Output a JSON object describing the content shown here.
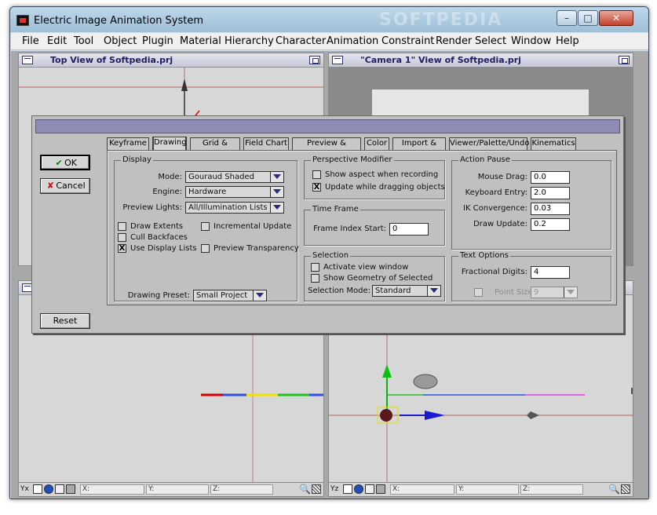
{
  "window": {
    "title": "Electric Image Animation System",
    "watermark": "SOFTPEDIA",
    "minimize": "–",
    "maximize": "□",
    "close": "✕"
  },
  "menu": [
    "File",
    "Edit",
    "Tool",
    "Object",
    "Plugin",
    "Material",
    "Hierarchy",
    "Character",
    "Animation",
    "Constraint",
    "Render",
    "Select",
    "Window",
    "Help"
  ],
  "viewports": {
    "top_left_title": "Top View of Softpedia.prj",
    "top_right_title": "\"Camera 1\" View of Softpedia.prj"
  },
  "status": {
    "axis_left": "Yx",
    "axis_right": "Yz",
    "x_label": "X:",
    "y_label": "Y:",
    "z_label": "Z:"
  },
  "dialog": {
    "ok": "OK",
    "cancel": "Cancel",
    "reset": "Reset",
    "tabs": [
      "Keyframe",
      "Drawing",
      "Grid & Scale",
      "Field Chart",
      "Preview & Render",
      "Color",
      "Import & Data",
      "Viewer/Palette/Undo",
      "Kinematics"
    ],
    "active_tab": "Drawing",
    "display": {
      "title": "Display",
      "mode_label": "Mode:",
      "mode_value": "Gouraud Shaded",
      "engine_label": "Engine:",
      "engine_value": "Hardware",
      "preview_lights_label": "Preview Lights:",
      "preview_lights_value": "All/Illumination Lists",
      "draw_extents": "Draw Extents",
      "cull_backfaces": "Cull Backfaces",
      "use_display_lists": "Use Display Lists",
      "incremental_update": "Incremental Update",
      "preview_transparency": "Preview Transparency",
      "drawing_preset_label": "Drawing Preset:",
      "drawing_preset_value": "Small Project"
    },
    "perspective": {
      "title": "Perspective Modifier",
      "show_aspect": "Show aspect when recording",
      "update_dragging": "Update while dragging objects"
    },
    "time_frame": {
      "title": "Time Frame",
      "frame_index_label": "Frame Index Start:",
      "frame_index_value": "0"
    },
    "selection": {
      "title": "Selection",
      "activate_view": "Activate view window",
      "show_geometry": "Show Geometry of Selected",
      "mode_label": "Selection Mode:",
      "mode_value": "Standard"
    },
    "action_pause": {
      "title": "Action Pause",
      "mouse_drag_label": "Mouse Drag:",
      "mouse_drag_value": "0.0",
      "keyboard_entry_label": "Keyboard Entry:",
      "keyboard_entry_value": "2.0",
      "ik_label": "IK Convergence:",
      "ik_value": "0.03",
      "draw_update_label": "Draw Update:",
      "draw_update_value": "0.2"
    },
    "text_options": {
      "title": "Text Options",
      "fractional_label": "Fractional Digits:",
      "fractional_value": "4",
      "point_size_label": "Point Size:",
      "point_size_value": "9"
    },
    "checked_mark": "X"
  }
}
